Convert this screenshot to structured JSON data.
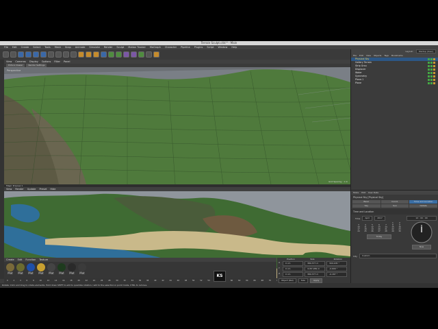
{
  "window": {
    "title": "Terrain Sculpt.c4d * - Main"
  },
  "menubar": [
    "File",
    "Edit",
    "Create",
    "Select",
    "Tools",
    "Mesh",
    "Snap",
    "Animate",
    "Simulate",
    "Render",
    "Sculpt",
    "Motion Tracker",
    "MoGraph",
    "Character",
    "Pipeline",
    "Plugins",
    "Script",
    "Window",
    "Help"
  ],
  "layout": {
    "label": "Layout:",
    "value": "Startup (User)"
  },
  "viewport1": {
    "menu": [
      "View",
      "Cameras",
      "Display",
      "Options",
      "Filter",
      "Panel"
    ],
    "tabs": [
      "Picture Viewer",
      "Render Settings"
    ],
    "label": "Perspective",
    "grid_spacing": "Grid Spacing : 1 m"
  },
  "viewport2": {
    "title": "Magic Preview 1",
    "menu": [
      "View",
      "Render",
      "Update",
      "Preset",
      "Hide"
    ]
  },
  "object_manager": {
    "menu": [
      "File",
      "Edit",
      "View",
      "Objects",
      "Tags",
      "Bookmarks"
    ],
    "objects": [
      {
        "name": "Physical Sky",
        "selected": true
      },
      {
        "name": "Gallery Terrain",
        "selected": false
      },
      {
        "name": "Strip Grou",
        "selected": false
      },
      {
        "name": "Displacer",
        "selected": false
      },
      {
        "name": "Water",
        "selected": false
      },
      {
        "name": "Symmetry",
        "selected": false
      },
      {
        "name": "Plane.1",
        "selected": false
      },
      {
        "name": "Plane",
        "selected": false
      }
    ]
  },
  "attributes": {
    "menu": [
      "Mode",
      "Edit",
      "User Data"
    ],
    "title": "Physical Sky [Physical Sky]",
    "tabs_row1": [
      "Basic",
      "Coord.",
      "Time and Location"
    ],
    "tabs_row2": [
      "Sky",
      "Sun",
      "Details"
    ],
    "section": "Time and Location",
    "time_label": "Time",
    "month": "April",
    "year": "2017",
    "clock": "12 : 00 : 00",
    "today_button": "Today",
    "now_button": "Now",
    "city_label": "City",
    "city_value": "Custom",
    "calendar_rows": [
      [
        "",
        "",
        "",
        "",
        "",
        "1",
        "2"
      ],
      [
        "3",
        "4",
        "5",
        "6",
        "7",
        "8",
        "9"
      ],
      [
        "10",
        "11",
        "12",
        "13",
        "14",
        "15",
        "16"
      ],
      [
        "17",
        "18",
        "19",
        "20",
        "21",
        "22",
        "23"
      ],
      [
        "24",
        "25",
        "26",
        "27",
        "28",
        "29",
        "30"
      ]
    ]
  },
  "timeline": {
    "ticks": [
      "0",
      "2",
      "4",
      "6",
      "8",
      "10",
      "12",
      "14",
      "16",
      "18",
      "20",
      "22",
      "24",
      "26",
      "28",
      "30",
      "32",
      "34",
      "36",
      "38",
      "40",
      "42",
      "44",
      "46",
      "48",
      "50",
      "52",
      "54",
      "56",
      "58",
      "60",
      "62",
      "64",
      "66",
      "68",
      "70",
      "72",
      "74",
      "76",
      "78",
      "80",
      "82",
      "84",
      "86",
      "88",
      "90"
    ],
    "start": "0 F",
    "end": "90 F",
    "current": "0 F",
    "right": "72 F"
  },
  "materials": {
    "menu": [
      "Create",
      "Edit",
      "Function",
      "Texture"
    ],
    "items": [
      "Mat",
      "Mat",
      "Mat",
      "Mat",
      "Mat",
      "Mat",
      "Mat",
      "Mat"
    ]
  },
  "coordinates": {
    "headers": [
      "Position",
      "Size",
      "Rotation"
    ],
    "rows": [
      {
        "axis": "X",
        "pos": "0 cm",
        "size": "380.377 m",
        "rot": "300.205 °"
      },
      {
        "axis": "Y",
        "pos": "0 cm",
        "size": "1187.289 m",
        "rot": "-0.609 °"
      },
      {
        "axis": "Z",
        "pos": "0 cm",
        "size": "380.377 m",
        "rot": "-0.187 °"
      }
    ],
    "mode": "Object (Rel)",
    "size_mode": "Size",
    "apply": "Apply"
  },
  "status": "Rotate: Click and drag to rotate elements. Hold down SHIFT to add to quantize rotation / add to the selection in point mode, CTRL to remove.",
  "watermark": "KS",
  "colors": {
    "accent": "#3a6ea5",
    "selected": "#ffcf44",
    "terrain": "#4f7a3c",
    "water": "#2f6f9a",
    "sand": "#c9b98a"
  }
}
